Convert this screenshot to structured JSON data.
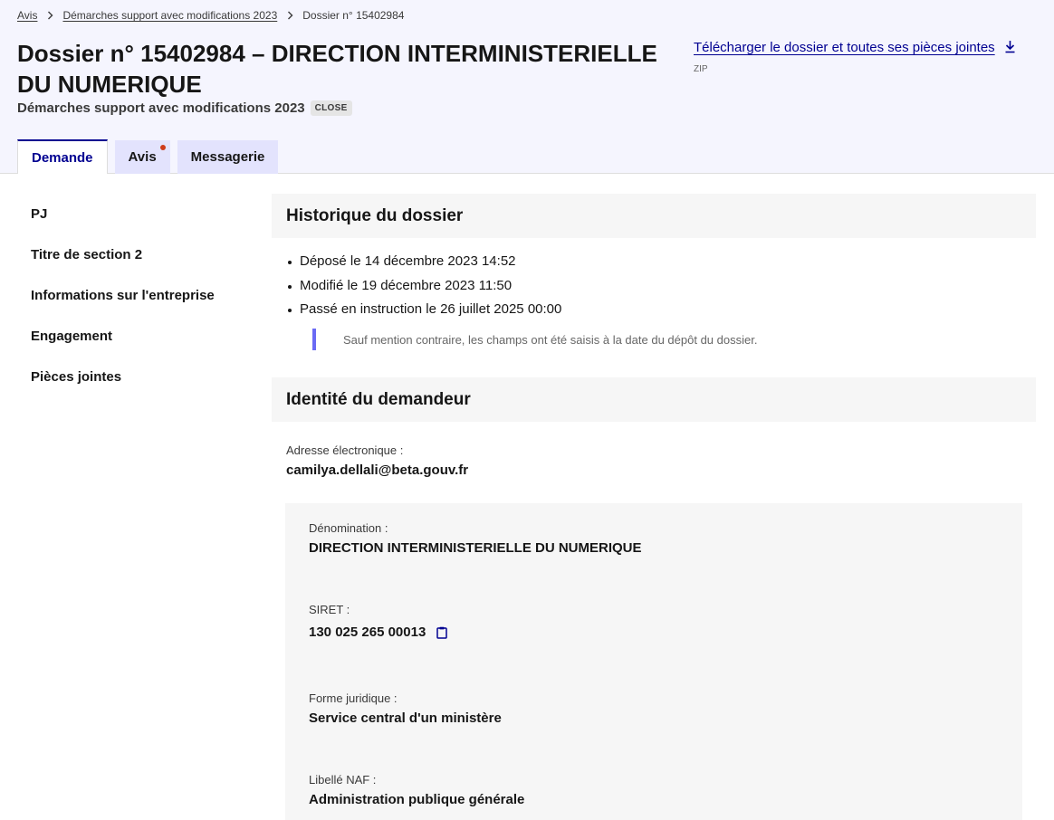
{
  "breadcrumb": {
    "items": [
      "Avis",
      "Démarches support avec modifications 2023"
    ],
    "current": "Dossier n° 15402984"
  },
  "header": {
    "title": "Dossier n° 15402984 – DIRECTION INTERMINISTERIELLE DU NUMERIQUE",
    "procedure": "Démarches support avec modifications 2023",
    "status_badge": "CLOSE",
    "download_label": "Télécharger le dossier et toutes ses pièces jointes",
    "download_format": "ZIP",
    "download_icon": "download-icon"
  },
  "tabs": [
    {
      "label": "Demande",
      "active": true
    },
    {
      "label": "Avis",
      "notification": true
    },
    {
      "label": "Messagerie"
    }
  ],
  "sidebar": {
    "items": [
      "PJ",
      "Titre de section 2",
      "Informations sur l'entreprise",
      "Engagement",
      "Pièces jointes"
    ]
  },
  "historique": {
    "title": "Historique du dossier",
    "events": [
      "Déposé le 14 décembre 2023 14:52",
      "Modifié le 19 décembre 2023 11:50",
      "Passé en instruction le 26 juillet 2025 00:00"
    ],
    "notice": "Sauf mention contraire, les champs ont été saisis à la date du dépôt du dossier."
  },
  "identite": {
    "title": "Identité du demandeur",
    "email_label": "Adresse électronique  :",
    "email_value": "camilya.dellali@beta.gouv.fr",
    "entreprise": {
      "denomination_label": "Dénomination :",
      "denomination_value": "DIRECTION INTERMINISTERIELLE DU NUMERIQUE",
      "siret_label": "SIRET :",
      "siret_value": "130 025 265 00013",
      "siret_copy_icon": "clipboard-icon",
      "forme_label": "Forme juridique :",
      "forme_value": "Service central d'un ministère",
      "naf_label": "Libellé NAF :",
      "naf_value": "Administration publique générale"
    }
  },
  "colors": {
    "primary": "#000091",
    "header_bg": "#f5f5fe",
    "tab_bg": "#e3e3fd",
    "notification_dot": "#ce3b1a",
    "callout_border": "#6a6af4",
    "section_bg": "#f6f6f6"
  }
}
